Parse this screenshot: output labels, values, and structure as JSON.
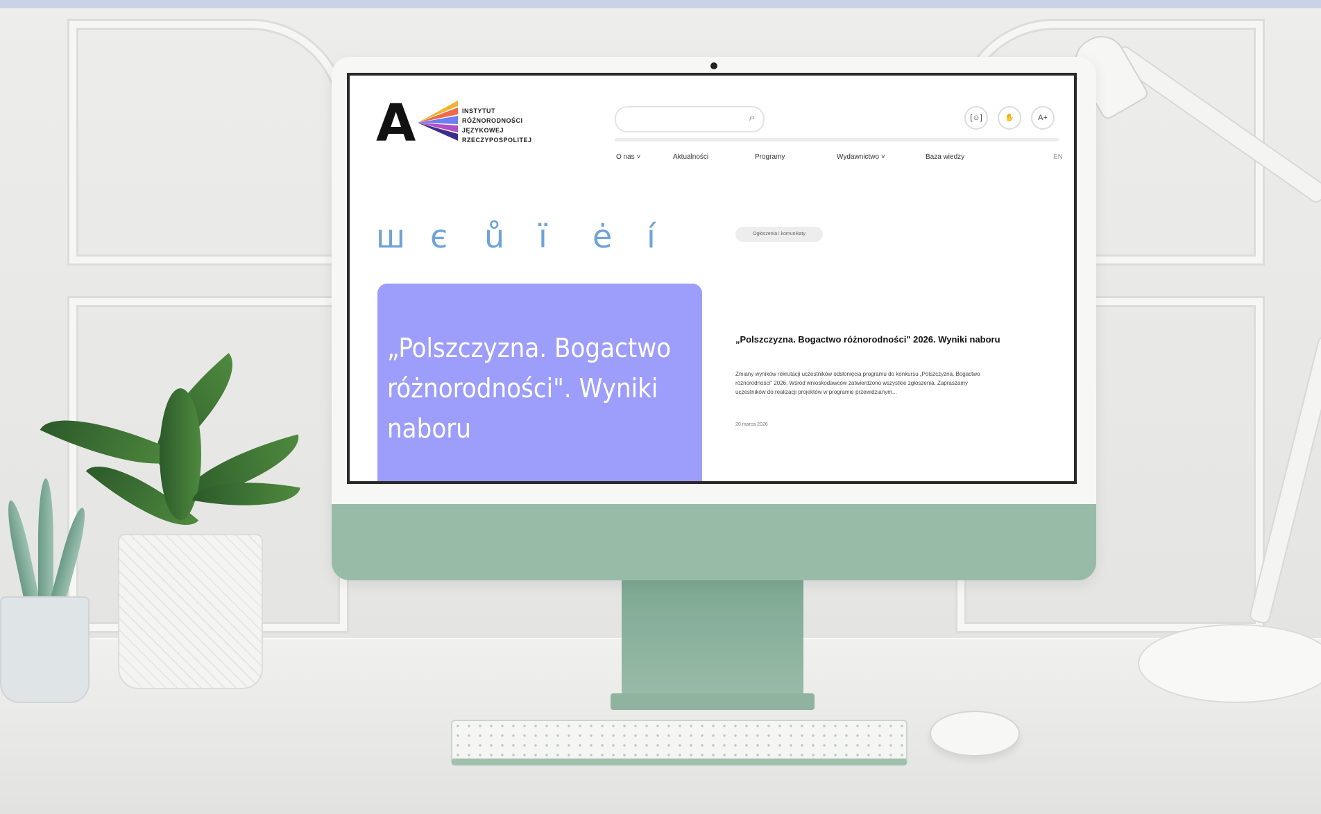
{
  "colors": {
    "wall": "#ececea",
    "monitor_body": "#98bba8",
    "hero_bg": "#9d9dfb",
    "glyph_color": "#6fa3d8",
    "screen_border": "#2a2a2a"
  },
  "site": {
    "logo_letter": "A",
    "logo_lines": [
      "INSTYTUT",
      "RÓŻNORODNOŚCI",
      "JĘZYKOWEJ",
      "RZECZYPOSPOLITEJ"
    ],
    "search": {
      "placeholder": "",
      "icon": "search-icon"
    },
    "nav": [
      "O nas ˅",
      "Aktualności",
      "Programy",
      "Wydawnictwo ˅",
      "Baza wiedzy",
      "EN"
    ],
    "accessibility": [
      "[☺]",
      "✋",
      "A+"
    ]
  },
  "hero": {
    "glyphs": [
      "ш",
      "є",
      "ů",
      "ï",
      "ė",
      "í"
    ],
    "title": "„Polszczyzna. Bogactwo różnorodności\". Wyniki naboru"
  },
  "article": {
    "tag": "Ogłoszenia i komunikaty",
    "title": "„Polszczyzna. Bogactwo różnorodności\" 2026. Wyniki naboru",
    "body": "Zmiany wyników rekrutacji uczestników odsłonięcia programu do konkursu „Polszczyzna. Bogactwo różnorodności\" 2026. Wśród wnioskodawców zatwierdzono wszystkie zgłoszenia. Zapraszamy uczestników do realizacji projektów w programie przewidzianym...",
    "date": "20 marca 2026"
  }
}
